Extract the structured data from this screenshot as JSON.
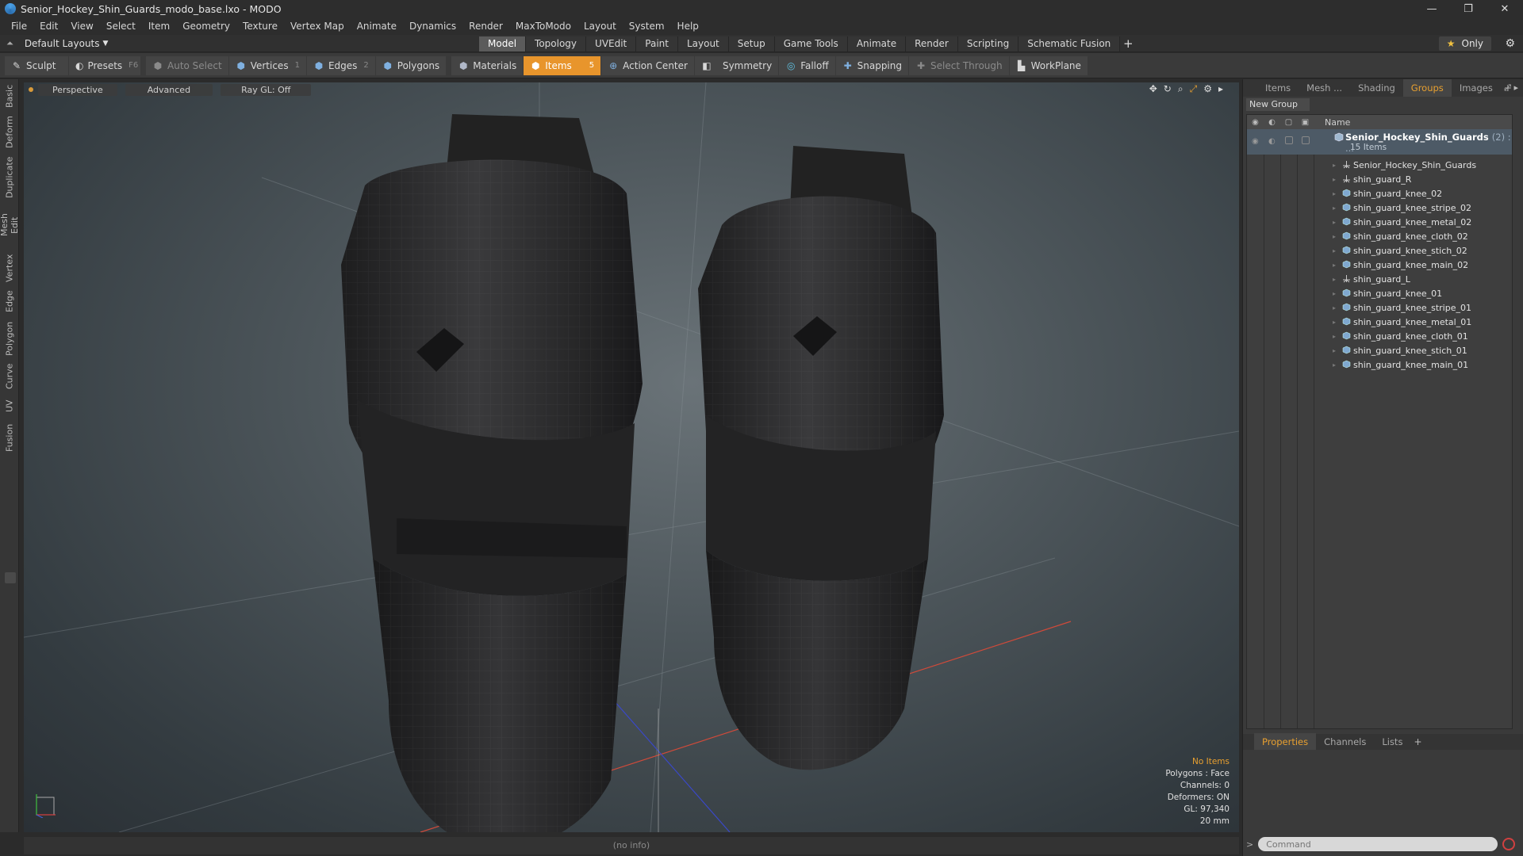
{
  "window": {
    "title": "Senior_Hockey_Shin_Guards_modo_base.lxo - MODO",
    "minimize": "—",
    "restore": "❐",
    "close": "✕"
  },
  "menu": [
    "File",
    "Edit",
    "View",
    "Select",
    "Item",
    "Geometry",
    "Texture",
    "Vertex Map",
    "Animate",
    "Dynamics",
    "Render",
    "MaxToModo",
    "Layout",
    "System",
    "Help"
  ],
  "layout": {
    "current": "Default Layouts",
    "tabs": [
      "Model",
      "Topology",
      "UVEdit",
      "Paint",
      "Layout",
      "Setup",
      "Game Tools",
      "Animate",
      "Render",
      "Scripting",
      "Schematic Fusion"
    ],
    "active_tab": "Model",
    "add": "+",
    "only_label": "Only"
  },
  "toolbar": {
    "sculpt": "Sculpt",
    "presets": "Presets",
    "presets_key": "F6",
    "auto_select": "Auto Select",
    "vertices": "Vertices",
    "vertices_key": "1",
    "edges": "Edges",
    "edges_key": "2",
    "polygons": "Polygons",
    "materials": "Materials",
    "items": "Items",
    "items_key": "5",
    "action_center": "Action Center",
    "symmetry": "Symmetry",
    "falloff": "Falloff",
    "snapping": "Snapping",
    "select_through": "Select Through",
    "workplane": "WorkPlane"
  },
  "left_tabs": [
    "Basic",
    "Deform",
    "Duplicate",
    "Mesh Edit",
    "Vertex",
    "Edge",
    "Polygon",
    "Curve",
    "UV",
    "Fusion"
  ],
  "viewport": {
    "view": "Perspective",
    "shading": "Advanced",
    "raygl": "Ray GL: Off",
    "info": {
      "selection": "No Items",
      "polygons": "Polygons : Face",
      "channels": "Channels: 0",
      "deformers": "Deformers: ON",
      "gl": "GL: 97,340",
      "scale": "20 mm"
    }
  },
  "status": "(no info)",
  "panel": {
    "tabs": [
      "Items",
      "Mesh ...",
      "Shading",
      "Groups",
      "Images"
    ],
    "active_tab": "Groups",
    "new_group": "New Group",
    "name_header": "Name",
    "group": {
      "name": "Senior_Hockey_Shin_Guards",
      "count": "(2) : ...",
      "sub": "15 Items"
    },
    "items": [
      {
        "label": "Senior_Hockey_Shin_Guards",
        "icon": "locator-icon"
      },
      {
        "label": "shin_guard_R",
        "icon": "locator-icon"
      },
      {
        "label": "shin_guard_knee_02",
        "icon": "mesh-icon"
      },
      {
        "label": "shin_guard_knee_stripe_02",
        "icon": "mesh-icon"
      },
      {
        "label": "shin_guard_knee_metal_02",
        "icon": "mesh-icon"
      },
      {
        "label": "shin_guard_knee_cloth_02",
        "icon": "mesh-icon"
      },
      {
        "label": "shin_guard_knee_stich_02",
        "icon": "mesh-icon"
      },
      {
        "label": "shin_guard_knee_main_02",
        "icon": "mesh-icon"
      },
      {
        "label": "shin_guard_L",
        "icon": "locator-icon"
      },
      {
        "label": "shin_guard_knee_01",
        "icon": "mesh-icon"
      },
      {
        "label": "shin_guard_knee_stripe_01",
        "icon": "mesh-icon"
      },
      {
        "label": "shin_guard_knee_metal_01",
        "icon": "mesh-icon"
      },
      {
        "label": "shin_guard_knee_cloth_01",
        "icon": "mesh-icon"
      },
      {
        "label": "shin_guard_knee_stich_01",
        "icon": "mesh-icon"
      },
      {
        "label": "shin_guard_knee_main_01",
        "icon": "mesh-icon"
      }
    ],
    "props_tabs": [
      "Properties",
      "Channels",
      "Lists"
    ],
    "props_active": "Properties",
    "command_placeholder": "Command"
  },
  "colors": {
    "accent": "#e8952c",
    "selected_row": "#4d5a66"
  }
}
